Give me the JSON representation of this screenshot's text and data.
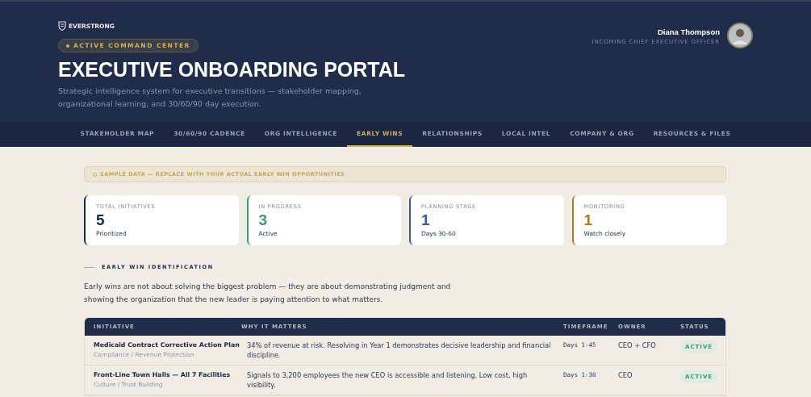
{
  "brand": {
    "name": "EVERSTRONG"
  },
  "badge": {
    "label": "ACTIVE COMMAND CENTER"
  },
  "title": "EXECUTIVE ONBOARDING PORTAL",
  "subtitle": "Strategic intelligence system for executive transitions — stakeholder mapping, organizational learning, and 30/60/90 day execution.",
  "user": {
    "name": "Diana Thompson",
    "role": "INCOMING CHIEF EXECUTIVE OFFICER"
  },
  "tabs": [
    {
      "label": "STAKEHOLDER MAP",
      "selected": false
    },
    {
      "label": "30/60/90 CADENCE",
      "selected": false
    },
    {
      "label": "ORG INTELLIGENCE",
      "selected": false
    },
    {
      "label": "EARLY WINS",
      "selected": true
    },
    {
      "label": "RELATIONSHIPS",
      "selected": false
    },
    {
      "label": "LOCAL INTEL",
      "selected": false
    },
    {
      "label": "COMPANY & ORG",
      "selected": false
    },
    {
      "label": "RESOURCES & FILES",
      "selected": false
    }
  ],
  "notice": "SAMPLE DATA — REPLACE WITH YOUR ACTUAL EARLY WIN OPPORTUNITIES",
  "stats": [
    {
      "label": "TOTAL INITIATIVES",
      "value": "5",
      "note": "Prioritized",
      "color": "#1b2745"
    },
    {
      "label": "IN PROGRESS",
      "value": "3",
      "note": "Active",
      "color": "#3d9a6e"
    },
    {
      "label": "PLANNING STAGE",
      "value": "1",
      "note": "Days 30-60",
      "color": "#3a55c0"
    },
    {
      "label": "MONITORING",
      "value": "1",
      "note": "Watch closely",
      "color": "#b07a22"
    }
  ],
  "section": {
    "heading": "EARLY WIN IDENTIFICATION",
    "intro": "Early wins are not about solving the biggest problem — they are about demonstrating judgment and showing the organization that the new leader is paying attention to what matters."
  },
  "table": {
    "columns": [
      "INITIATIVE",
      "WHY IT MATTERS",
      "TIMEFRAME",
      "OWNER",
      "STATUS"
    ],
    "rows": [
      {
        "initiative": "Medicaid Contract Corrective Action Plan",
        "category": "Compliance / Revenue Protection",
        "why": "34% of revenue at risk. Resolving in Year 1 demonstrates decisive leadership and financial discipline.",
        "timeframe": "Days 1-45",
        "owner": "CEO + CFO",
        "status": "ACTIVE"
      },
      {
        "initiative": "Front-Line Town Halls — All 7 Facilities",
        "category": "Culture / Trust Building",
        "why": "Signals to 3,200 employees the new CEO is accessible and listening. Low cost, high visibility.",
        "timeframe": "Days 1-30",
        "owner": "CEO",
        "status": "ACTIVE"
      }
    ]
  }
}
